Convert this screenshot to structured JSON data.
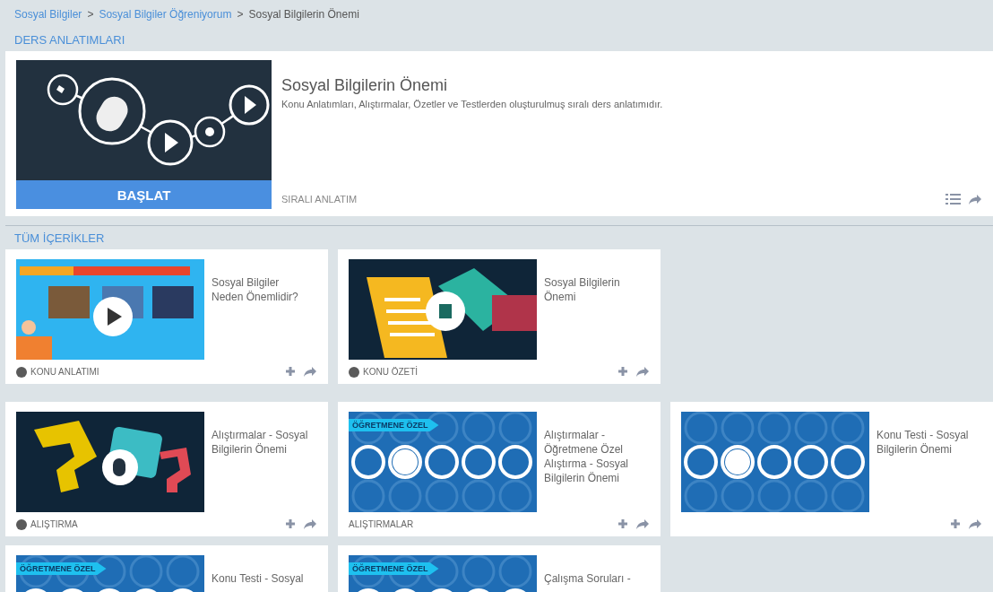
{
  "breadcrumb": [
    {
      "label": "Sosyal Bilgiler",
      "link": true
    },
    {
      "label": "Sosyal Bilgiler Öğreniyorum",
      "link": true
    },
    {
      "label": "Sosyal Bilgilerin Önemi",
      "link": false
    }
  ],
  "breadcrumb_separator": ">",
  "lesson_section": {
    "heading": "DERS ANLATIMLARI",
    "title": "Sosyal Bilgilerin Önemi",
    "description": "Konu Anlatımları, Alıştırmalar, Özetler ve Testlerden oluşturulmuş sıralı ders anlatımıdır.",
    "start_button": "BAŞLAT",
    "type_label": "SIRALI ANLATIM"
  },
  "content_section": {
    "heading": "TÜM İÇERİKLER",
    "groups": [
      [
        {
          "kind": "video",
          "title": "Sosyal Bilgiler Neden Önemlidir?",
          "type_label": "KONU ANLATIMI",
          "dot": true
        },
        {
          "kind": "summary",
          "title": "Sosyal Bilgilerin Önemi",
          "type_label": "KONU ÖZETİ",
          "dot": true
        }
      ],
      [
        {
          "kind": "exercise",
          "title": "Alıştırmalar - Sosyal Bilgilerin Önemi",
          "type_label": "ALIŞTIRMA",
          "dot": true
        },
        {
          "kind": "test",
          "title": "Alıştırmalar - Öğretmene Özel Alıştırma - Sosyal Bilgilerin Önemi",
          "type_label": "ALIŞTIRMALAR",
          "dot": false,
          "badge": "ÖĞRETMENE ÖZEL"
        },
        {
          "kind": "test",
          "title": "Konu Testi - Sosyal Bilgilerin Önemi",
          "dot": false
        },
        {
          "kind": "test",
          "title": "Konu Testi - Sosyal",
          "badge": "ÖĞRETMENE ÖZEL"
        },
        {
          "kind": "test",
          "title": "Çalışma Soruları -",
          "badge": "ÖĞRETMENE ÖZEL"
        }
      ]
    ]
  }
}
